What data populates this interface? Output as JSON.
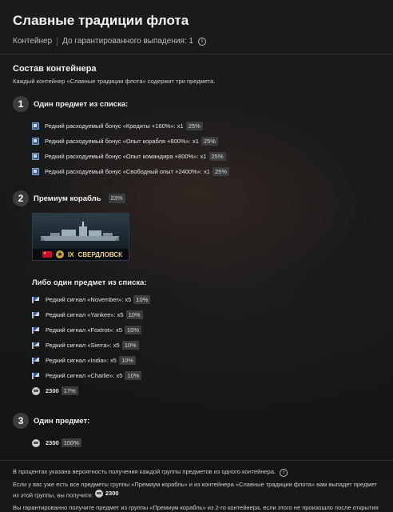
{
  "title": "Славные традиции флота",
  "meta": {
    "type": "Контейнер",
    "guarantee": "До гарантированного выпадения: 1"
  },
  "contents": {
    "heading": "Состав контейнера",
    "description": "Каждый контейнер «Славные традиции флота» содержит три предмета."
  },
  "steps": [
    {
      "number": "1",
      "label": "Один предмет из списка:",
      "items": [
        {
          "icon": "bonus-icon",
          "text": "Редкий расходуемый бонус «Кредиты +160%»: x1",
          "chance": "25%"
        },
        {
          "icon": "bonus-icon",
          "text": "Редкий расходуемый бонус «Опыт корабля +800%»: x1",
          "chance": "25%"
        },
        {
          "icon": "bonus-icon",
          "text": "Редкий расходуемый бонус «Опыт командира +800%»: x1",
          "chance": "25%"
        },
        {
          "icon": "bonus-icon",
          "text": "Редкий расходуемый бонус «Свободный опыт +2400%»: x1",
          "chance": "25%"
        }
      ]
    },
    {
      "number": "2",
      "label": "Премиум корабль",
      "chance": "23%",
      "ship": {
        "level": "IX",
        "name": "СВЕРДЛОВСК"
      },
      "alt_label": "Либо один предмет из списка:",
      "items": [
        {
          "icon": "signal-flag-icon",
          "text": "Редкий сигнал «November»: x5",
          "chance": "10%"
        },
        {
          "icon": "signal-flag-icon",
          "text": "Редкий сигнал «Yankee»: x5",
          "chance": "10%"
        },
        {
          "icon": "signal-flag-icon",
          "text": "Редкий сигнал «Foxtrot»: x5",
          "chance": "10%"
        },
        {
          "icon": "signal-flag-icon",
          "text": "Редкий сигнал «Sierra»: x5",
          "chance": "10%"
        },
        {
          "icon": "signal-flag-icon",
          "text": "Редкий сигнал «India»: x5",
          "chance": "10%"
        },
        {
          "icon": "signal-flag-icon",
          "text": "Редкий сигнал «Charlie»: x5",
          "chance": "10%"
        },
        {
          "icon": "credits-icon",
          "text": "2300",
          "chance": "17%"
        }
      ]
    },
    {
      "number": "3",
      "label": "Один предмет:",
      "items": [
        {
          "icon": "credits-icon",
          "text": "2300",
          "chance": "100%"
        }
      ]
    }
  ],
  "footer": {
    "note1": "В процентах указана вероятность получения каждой группы предметов из одного контейнера.",
    "note2_a": "Если у вас уже есть все предметы группы «Премиум корабль» и из контейнера «Славные традиции флота» вам выпадет предмет из этой группы, вы получите:",
    "note2_value": "2300",
    "note3": "Вы гарантированно получите предмет из группы «Премиум корабль» из 2-го контейнера, если этого не произошло после открытия"
  },
  "colors": {
    "background": "#161718",
    "badge": "#3a3c3e",
    "ship_name": "#f0d38a"
  }
}
